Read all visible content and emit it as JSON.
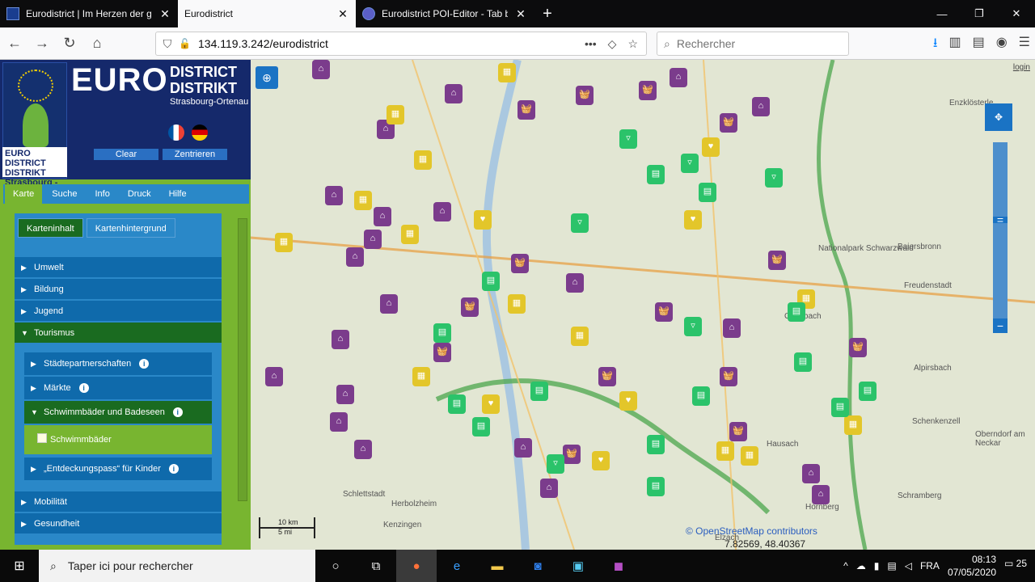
{
  "browser": {
    "tabs": [
      {
        "title": "Eurodistrict | Im Herzen der gre",
        "close": "✕"
      },
      {
        "title": "Eurodistrict",
        "close": "✕"
      },
      {
        "title": "Eurodistrict POI-Editor - Tab be",
        "close": "✕"
      }
    ],
    "new_tab": "+",
    "window_controls": [
      "—",
      "❐",
      "✕"
    ],
    "url": "134.119.3.242/eurodistrict",
    "search_placeholder": "Rechercher"
  },
  "sidebar": {
    "logo": {
      "big": "EURO",
      "district1": "DISTRICT",
      "district2": "DISTRIKT",
      "sub": "Strasbourg-Ortenau",
      "mini": "EURO DISTRICT DISTRIKT Strasbourg - Ortenau"
    },
    "buttons": {
      "clear": "Clear",
      "center": "Zentrieren"
    },
    "main_tabs": [
      "Karte",
      "Suche",
      "Info",
      "Druck",
      "Hilfe"
    ],
    "sub_tabs": [
      "Karteninhalt",
      "Kartenhintergrund"
    ],
    "categories": [
      {
        "label": "Umwelt"
      },
      {
        "label": "Bildung"
      },
      {
        "label": "Jugend"
      },
      {
        "label": "Tourismus"
      },
      {
        "label": "Mobilität"
      },
      {
        "label": "Gesundheit"
      }
    ],
    "tourism_sub": [
      {
        "label": "Städtepartnerschaften"
      },
      {
        "label": "Märkte"
      },
      {
        "label": "Schwimmbäder und Badeseen"
      },
      {
        "label": "„Entdeckungspass“ für Kinder"
      }
    ],
    "layer_item": "Schwimmbäder"
  },
  "map": {
    "login": "login",
    "places": [
      "Enzklösterle",
      "Baiersbronn",
      "Freudenstadt",
      "Alpirsbach",
      "Schenkenzell",
      "Oberndorf am Neckar",
      "Schramberg",
      "Hornberg",
      "Hausach",
      "Herbolzheim",
      "Kenzingen",
      "Schlettstadt",
      "Elzach",
      "Nationalpark Schwarzwald",
      "Griesbach"
    ],
    "attribution": "© OpenStreetMap contributors",
    "coords": "7.82569, 48.40367",
    "scale_km": "10 km",
    "scale_mi": "5 mi"
  },
  "taskbar": {
    "search_placeholder": "Taper ici pour rechercher",
    "lang": "FRA",
    "time": "08:13",
    "date": "07/05/2020",
    "notifications": "25"
  }
}
